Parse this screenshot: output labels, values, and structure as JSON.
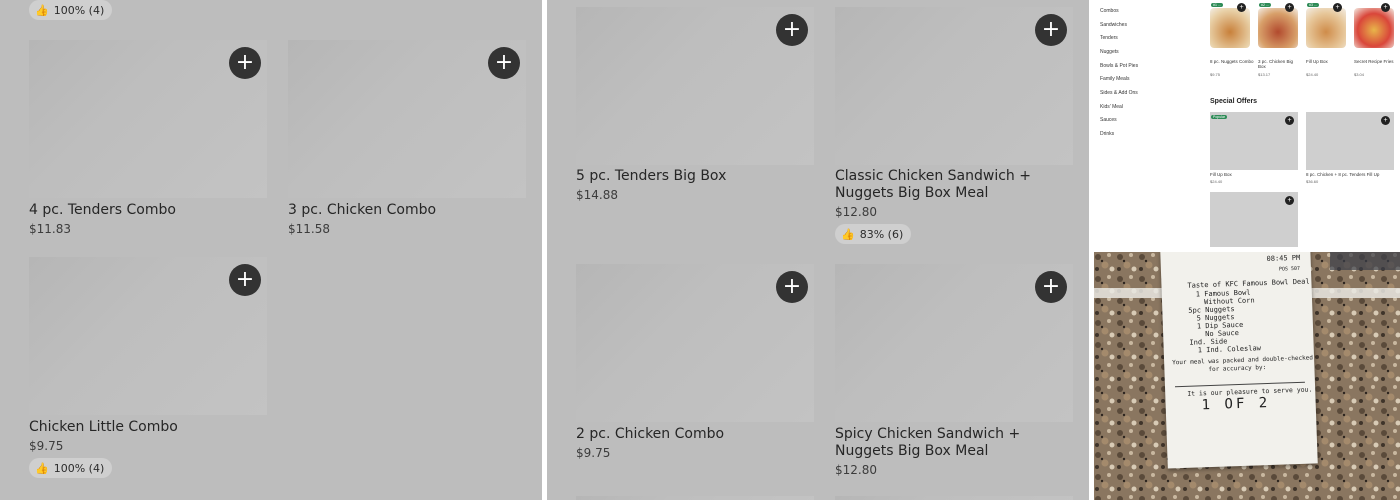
{
  "panel1": {
    "top_rating": "100% (4)",
    "items": [
      {
        "name": "4 pc. Tenders Combo",
        "price": "$11.83"
      },
      {
        "name": "3 pc. Chicken Combo",
        "price": "$11.58"
      },
      {
        "name": "Chicken Little Combo",
        "price": "$9.75",
        "rating": "100% (4)"
      }
    ]
  },
  "panel2": {
    "items": [
      {
        "name": "5 pc. Tenders Big Box",
        "price": "$14.88"
      },
      {
        "name": "Classic Chicken Sandwich + Nuggets Big Box Meal",
        "price": "$12.80",
        "rating": "83% (6)"
      },
      {
        "name": "2 pc. Chicken Combo",
        "price": "$9.75"
      },
      {
        "name": "Spicy Chicken Sandwich + Nuggets Big Box Meal",
        "price": "$12.80"
      }
    ]
  },
  "add_glyph": "+",
  "thumb_glyph": "👍",
  "icons": {
    "add": "plus-icon",
    "rating": "thumbs-up-icon"
  },
  "mini": {
    "sidebar": [
      "Combos",
      "Sandwiches",
      "Tenders",
      "Nuggets",
      "Bowls & Pot Pies",
      "Family Meals",
      "Sides & Add Ons",
      "Kids' Meal",
      "Sauces",
      "Drinks"
    ],
    "top_items": [
      {
        "name": "8 pc. Nuggets Combo",
        "price": "$9.75",
        "tag": "#1 ..."
      },
      {
        "name": "3 pc. Chicken Big Box",
        "price": "$13.17",
        "tag": "#2 ..."
      },
      {
        "name": "Fill Up Box",
        "price": "$24.40",
        "tag": "#3 ..."
      },
      {
        "name": "Secret Recipe Fries",
        "price": "$3.04",
        "tag": ""
      }
    ],
    "special_heading": "Special Offers",
    "special_tag": "Popular",
    "special_items": [
      {
        "name": "Fill Up Box",
        "price": "$24.40"
      },
      {
        "name": "8 pc. Chicken + 8 pc. Tenders Fill Up",
        "price": "$36.60"
      }
    ]
  },
  "receipt": {
    "lines": [
      "08:45 PM",
      "POS 507",
      "Taste of KFC Famous Bowl Deal",
      "1 Famous Bowl",
      "Without Corn",
      "5pc Nuggets",
      "5 Nuggets",
      "1 Dip Sauce",
      "No Sauce",
      "Ind. Side",
      "1 Ind. Coleslaw",
      "Your meal was packed and double-checked",
      "for accuracy by:",
      "It is our pleasure to serve you.",
      "1 OF 2"
    ]
  }
}
